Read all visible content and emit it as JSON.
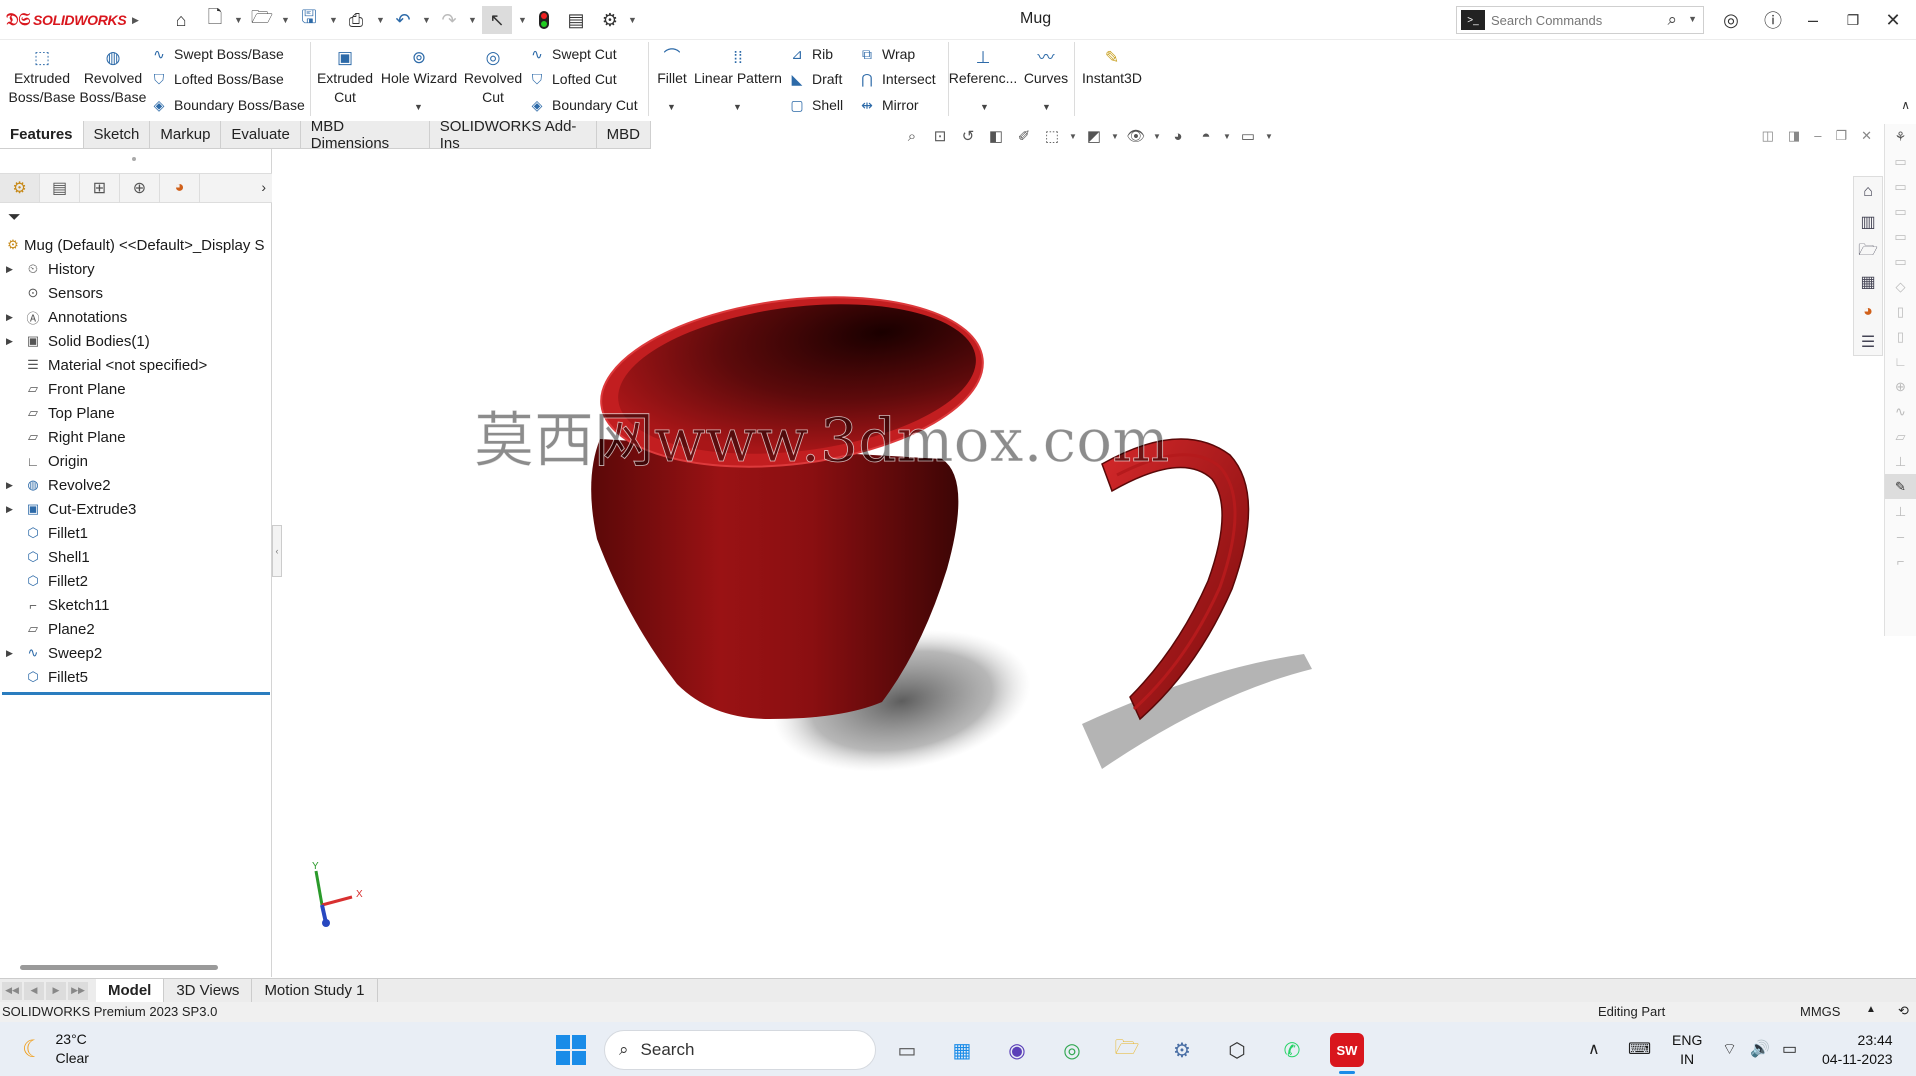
{
  "app": {
    "brand": "SOLIDWORKS",
    "title": "Mug"
  },
  "search": {
    "placeholder": "Search Commands"
  },
  "ribbon": {
    "extruded_boss": "Extruded Boss/Base",
    "revolved_boss": "Revolved Boss/Base",
    "swept_boss": "Swept Boss/Base",
    "lofted_boss": "Lofted Boss/Base",
    "boundary_boss": "Boundary Boss/Base",
    "extruded_cut": "Extruded Cut",
    "hole_wizard": "Hole Wizard",
    "revolved_cut": "Revolved Cut",
    "swept_cut": "Swept Cut",
    "lofted_cut": "Lofted Cut",
    "boundary_cut": "Boundary Cut",
    "fillet": "Fillet",
    "linear_pattern": "Linear Pattern",
    "rib": "Rib",
    "draft": "Draft",
    "shell": "Shell",
    "wrap": "Wrap",
    "intersect": "Intersect",
    "mirror": "Mirror",
    "reference": "Referenc...",
    "curves": "Curves",
    "instant3d": "Instant3D"
  },
  "command_tabs": [
    "Features",
    "Sketch",
    "Markup",
    "Evaluate",
    "MBD Dimensions",
    "SOLIDWORKS Add-Ins",
    "MBD"
  ],
  "tree": {
    "root": "Mug (Default) <<Default>_Display S",
    "items": [
      "History",
      "Sensors",
      "Annotations",
      "Solid Bodies(1)",
      "Material <not specified>",
      "Front Plane",
      "Top Plane",
      "Right Plane",
      "Origin",
      "Revolve2",
      "Cut-Extrude3",
      "Fillet1",
      "Shell1",
      "Fillet2",
      "Sketch11",
      "Plane2",
      "Sweep2",
      "Fillet5"
    ]
  },
  "watermark": "莫西网www.3dmox.com",
  "triad": {
    "x": "X",
    "y": "Y"
  },
  "model_color": "#a51416",
  "bottom_tabs": [
    "Model",
    "3D Views",
    "Motion Study 1"
  ],
  "status": {
    "version": "SOLIDWORKS Premium 2023 SP3.0",
    "mode": "Editing Part",
    "units": "MMGS"
  },
  "taskbar": {
    "temp": "23°C",
    "condition": "Clear",
    "search": "Search",
    "lang1": "ENG",
    "lang2": "IN",
    "time": "23:44",
    "date": "04-11-2023",
    "sw_badge": "SW"
  }
}
